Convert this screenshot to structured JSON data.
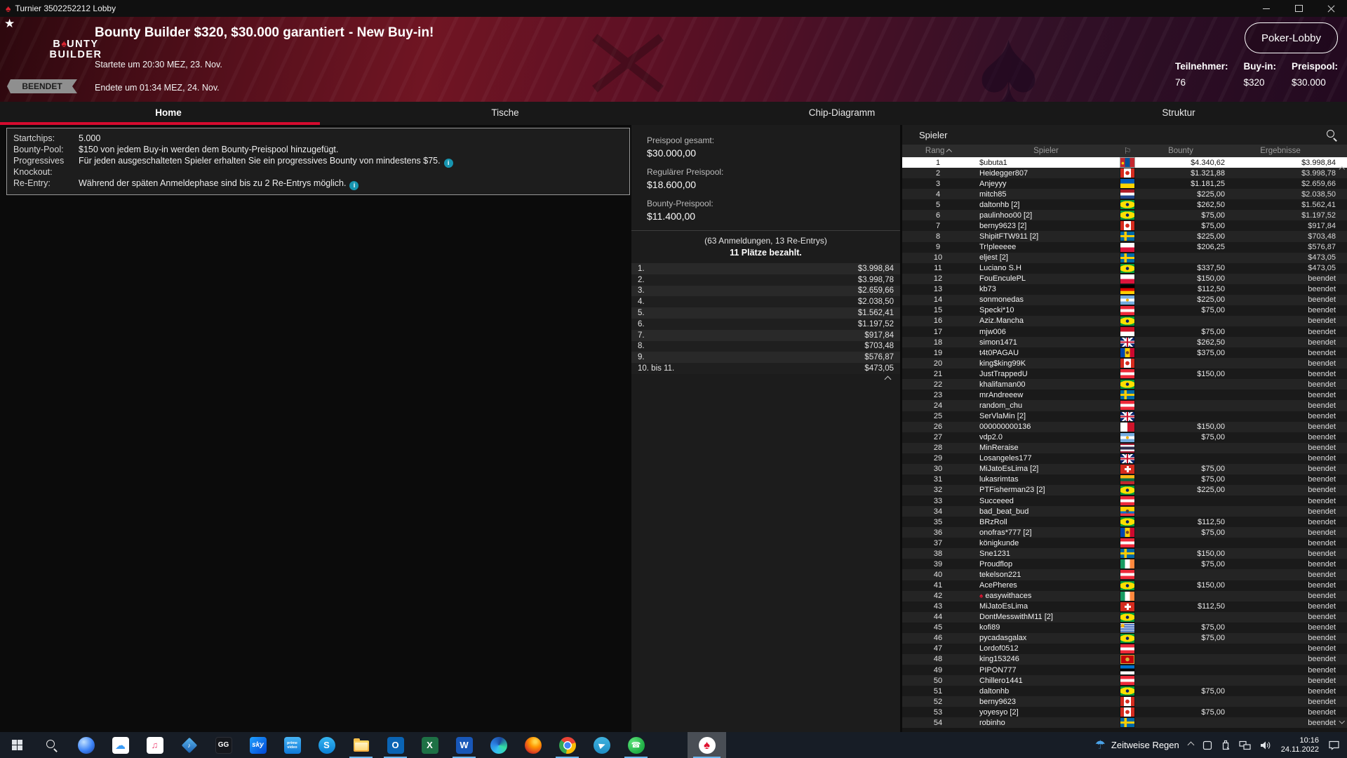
{
  "window": {
    "title": "Turnier 3502252212 Lobby"
  },
  "banner": {
    "logo": {
      "pre": "B",
      "spade": "♠",
      "post": "UNTY",
      "line2": "BUILDER"
    },
    "title": "Bounty Builder $320, $30.000 garantiert",
    "subtitle": "- New Buy-in!",
    "started": "Startete um 20:30 MEZ, 23. Nov.",
    "badge": "BEENDET",
    "ended": "Endete um 01:34 MEZ, 24. Nov.",
    "lobby_button": "Poker-Lobby",
    "stats": [
      {
        "label": "Teilnehmer:",
        "value": "76"
      },
      {
        "label": "Buy-in:",
        "value": "$320"
      },
      {
        "label": "Preispool:",
        "value": "$30.000"
      }
    ],
    "accent_red": "#d40a2e"
  },
  "tabs": [
    {
      "label": "Home",
      "active": true
    },
    {
      "label": "Tische",
      "active": false
    },
    {
      "label": "Chip-Diagramm",
      "active": false
    },
    {
      "label": "Struktur",
      "active": false
    }
  ],
  "info_panel": {
    "rows": [
      {
        "label": "Startchips:",
        "text": "5.000",
        "info": false
      },
      {
        "label": "Bounty-Pool:",
        "text": "$150 von jedem Buy-in werden dem Bounty-Preispool hinzugefügt.",
        "info": false
      },
      {
        "label": "Progressives Knockout:",
        "text": "Für jeden ausgeschalteten Spieler erhalten Sie ein progressives Bounty von mindestens $75.",
        "info": true
      },
      {
        "label": "Re-Entry:",
        "text": "Während der späten Anmeldephase sind bis zu 2 Re-Entrys möglich.",
        "info": true
      }
    ]
  },
  "prize_panel": {
    "totals": [
      {
        "label": "Preispool gesamt:",
        "value": "$30.000,00"
      },
      {
        "label": "Regulärer Preispool:",
        "value": "$18.600,00"
      },
      {
        "label": "Bounty-Preispool:",
        "value": "$11.400,00"
      }
    ],
    "registrations": "(63 Anmeldungen, 13 Re-Entrys)",
    "places_paid": "11 Plätze bezahlt.",
    "payouts": [
      {
        "place": "1.",
        "amount": "$3.998,84"
      },
      {
        "place": "2.",
        "amount": "$3.998,78"
      },
      {
        "place": "3.",
        "amount": "$2.659,66"
      },
      {
        "place": "4.",
        "amount": "$2.038,50"
      },
      {
        "place": "5.",
        "amount": "$1.562,41"
      },
      {
        "place": "6.",
        "amount": "$1.197,52"
      },
      {
        "place": "7.",
        "amount": "$917,84"
      },
      {
        "place": "8.",
        "amount": "$703,48"
      },
      {
        "place": "9.",
        "amount": "$576,87"
      },
      {
        "place": "10. bis 11.",
        "amount": "$473,05"
      }
    ]
  },
  "players_panel": {
    "title": "Spieler",
    "columns": {
      "rank": "Rang",
      "player": "Spieler",
      "bounty": "Bounty",
      "results": "Ergebnisse"
    },
    "rows": [
      {
        "rank": "1",
        "name": "$ubuta1",
        "flag": "mn",
        "bounty": "$4.340,62",
        "result": "$3.998,84",
        "selected": true
      },
      {
        "rank": "2",
        "name": "Heidegger807",
        "flag": "ca",
        "bounty": "$1.321,88",
        "result": "$3.998,78"
      },
      {
        "rank": "3",
        "name": "Anjeyyy",
        "flag": "ua",
        "bounty": "$1.181,25",
        "result": "$2.659,66"
      },
      {
        "rank": "4",
        "name": "mitch85",
        "flag": "nl",
        "bounty": "$225,00",
        "result": "$2.038,50"
      },
      {
        "rank": "5",
        "name": "daltonhb [2]",
        "flag": "br",
        "bounty": "$262,50",
        "result": "$1.562,41"
      },
      {
        "rank": "6",
        "name": "paulinhoo00 [2]",
        "flag": "br",
        "bounty": "$75,00",
        "result": "$1.197,52"
      },
      {
        "rank": "7",
        "name": "berny9623 [2]",
        "flag": "ca",
        "bounty": "$75,00",
        "result": "$917,84"
      },
      {
        "rank": "8",
        "name": "ShipitFTW911 [2]",
        "flag": "se",
        "bounty": "$225,00",
        "result": "$703,48"
      },
      {
        "rank": "9",
        "name": "Tr!pleeeee",
        "flag": "pl",
        "bounty": "$206,25",
        "result": "$576,87"
      },
      {
        "rank": "10",
        "name": "eljest [2]",
        "flag": "se",
        "bounty": "",
        "result": "$473,05"
      },
      {
        "rank": "11",
        "name": "Luciano S.H",
        "flag": "br",
        "bounty": "$337,50",
        "result": "$473,05"
      },
      {
        "rank": "12",
        "name": "FouEnculePL",
        "flag": "pl",
        "bounty": "$150,00",
        "result": "beendet"
      },
      {
        "rank": "13",
        "name": "kb73",
        "flag": "de",
        "bounty": "$112,50",
        "result": "beendet"
      },
      {
        "rank": "14",
        "name": "sonmonedas",
        "flag": "ar",
        "bounty": "$225,00",
        "result": "beendet"
      },
      {
        "rank": "15",
        "name": "Specki*10",
        "flag": "at",
        "bounty": "$75,00",
        "result": "beendet"
      },
      {
        "rank": "16",
        "name": "Aziz.Mancha",
        "flag": "br",
        "bounty": "",
        "result": "beendet"
      },
      {
        "rank": "17",
        "name": "mjw006",
        "flag": "id",
        "bounty": "$75,00",
        "result": "beendet"
      },
      {
        "rank": "18",
        "name": "simon1471",
        "flag": "gb",
        "bounty": "$262,50",
        "result": "beendet"
      },
      {
        "rank": "19",
        "name": "t4t0PAGAU",
        "flag": "md",
        "bounty": "$375,00",
        "result": "beendet"
      },
      {
        "rank": "20",
        "name": "king$king99K",
        "flag": "ca",
        "bounty": "",
        "result": "beendet"
      },
      {
        "rank": "21",
        "name": "JustTrappedU",
        "flag": "at",
        "bounty": "$150,00",
        "result": "beendet"
      },
      {
        "rank": "22",
        "name": "khalifaman00",
        "flag": "br",
        "bounty": "",
        "result": "beendet"
      },
      {
        "rank": "23",
        "name": "mrAndreeew",
        "flag": "se",
        "bounty": "",
        "result": "beendet"
      },
      {
        "rank": "24",
        "name": "random_chu",
        "flag": "at",
        "bounty": "",
        "result": "beendet"
      },
      {
        "rank": "25",
        "name": "SerVlaMin [2]",
        "flag": "gb",
        "bounty": "",
        "result": "beendet"
      },
      {
        "rank": "26",
        "name": "000000000136",
        "flag": "mt",
        "bounty": "$150,00",
        "result": "beendet"
      },
      {
        "rank": "27",
        "name": "vdp2.0",
        "flag": "ar",
        "bounty": "$75,00",
        "result": "beendet"
      },
      {
        "rank": "28",
        "name": "MinReraise",
        "flag": "th",
        "bounty": "",
        "result": "beendet"
      },
      {
        "rank": "29",
        "name": "Losangeles177",
        "flag": "gb",
        "bounty": "",
        "result": "beendet"
      },
      {
        "rank": "30",
        "name": "MiJatoEsLima [2]",
        "flag": "ch",
        "bounty": "$75,00",
        "result": "beendet"
      },
      {
        "rank": "31",
        "name": "lukasrimtas",
        "flag": "lt",
        "bounty": "$75,00",
        "result": "beendet"
      },
      {
        "rank": "32",
        "name": "PTFisherman23 [2]",
        "flag": "br",
        "bounty": "$225,00",
        "result": "beendet"
      },
      {
        "rank": "33",
        "name": "Succeeed",
        "flag": "at",
        "bounty": "",
        "result": "beendet"
      },
      {
        "rank": "34",
        "name": "bad_beat_bud",
        "flag": "ec",
        "bounty": "",
        "result": "beendet"
      },
      {
        "rank": "35",
        "name": "BRzRoll",
        "flag": "br",
        "bounty": "$112,50",
        "result": "beendet"
      },
      {
        "rank": "36",
        "name": "onofras*777 [2]",
        "flag": "md",
        "bounty": "$75,00",
        "result": "beendet"
      },
      {
        "rank": "37",
        "name": "königkunde",
        "flag": "at",
        "bounty": "",
        "result": "beendet"
      },
      {
        "rank": "38",
        "name": "Sne1231",
        "flag": "se",
        "bounty": "$150,00",
        "result": "beendet"
      },
      {
        "rank": "39",
        "name": "Proudflop",
        "flag": "ie",
        "bounty": "$75,00",
        "result": "beendet"
      },
      {
        "rank": "40",
        "name": "tekelson221",
        "flag": "at",
        "bounty": "",
        "result": "beendet"
      },
      {
        "rank": "41",
        "name": "AcePheres",
        "flag": "br",
        "bounty": "$150,00",
        "result": "beendet"
      },
      {
        "rank": "42",
        "name": "easywithaces",
        "flag": "ie",
        "bounty": "",
        "result": "beendet",
        "star": true
      },
      {
        "rank": "43",
        "name": "MiJatoEsLima",
        "flag": "ch",
        "bounty": "$112,50",
        "result": "beendet"
      },
      {
        "rank": "44",
        "name": "DontMesswithM11 [2]",
        "flag": "br",
        "bounty": "",
        "result": "beendet"
      },
      {
        "rank": "45",
        "name": "kofi89",
        "flag": "uy",
        "bounty": "$75,00",
        "result": "beendet"
      },
      {
        "rank": "46",
        "name": "pycadasgalax",
        "flag": "br",
        "bounty": "$75,00",
        "result": "beendet"
      },
      {
        "rank": "47",
        "name": "Lordof0512",
        "flag": "at",
        "bounty": "",
        "result": "beendet"
      },
      {
        "rank": "48",
        "name": "king153246",
        "flag": "me",
        "bounty": "",
        "result": "beendet"
      },
      {
        "rank": "49",
        "name": "PIPON777",
        "flag": "ee",
        "bounty": "",
        "result": "beendet"
      },
      {
        "rank": "50",
        "name": "Chillero1441",
        "flag": "at",
        "bounty": "",
        "result": "beendet"
      },
      {
        "rank": "51",
        "name": "daltonhb",
        "flag": "br",
        "bounty": "$75,00",
        "result": "beendet"
      },
      {
        "rank": "52",
        "name": "berny9623",
        "flag": "ca",
        "bounty": "",
        "result": "beendet"
      },
      {
        "rank": "53",
        "name": "yoyesyo [2]",
        "flag": "ca",
        "bounty": "$75,00",
        "result": "beendet"
      },
      {
        "rank": "54",
        "name": "robinho",
        "flag": "se",
        "bounty": "",
        "result": "beendet"
      }
    ]
  },
  "taskbar": {
    "apps": [
      {
        "icon": "start",
        "label": ""
      },
      {
        "icon": "search",
        "label": ""
      },
      {
        "icon": "photos",
        "label": ""
      },
      {
        "icon": "icloud",
        "label": ""
      },
      {
        "icon": "itunes",
        "label": ""
      },
      {
        "icon": "movies",
        "label": ""
      },
      {
        "icon": "gg",
        "label": "GG"
      },
      {
        "icon": "sky",
        "label": "sky"
      },
      {
        "icon": "prime",
        "label": "prime video"
      },
      {
        "icon": "skype",
        "label": "S"
      },
      {
        "icon": "explorer",
        "label": "",
        "underline": true
      },
      {
        "icon": "outlook",
        "label": "O",
        "underline": true
      },
      {
        "icon": "excel",
        "label": "X"
      },
      {
        "icon": "word",
        "label": "W",
        "underline": true
      },
      {
        "icon": "edge",
        "label": ""
      },
      {
        "icon": "firefox",
        "label": ""
      },
      {
        "icon": "chrome",
        "label": "",
        "underline": true
      },
      {
        "icon": "telegram",
        "label": ""
      },
      {
        "icon": "whatsapp",
        "label": "",
        "underline": true
      },
      {
        "icon": "spacer",
        "label": ""
      },
      {
        "icon": "pokerstars",
        "label": "",
        "underline": true,
        "active": true
      }
    ],
    "weather": "Zeitweise Regen",
    "time": "10:16",
    "date": "24.11.2022"
  }
}
